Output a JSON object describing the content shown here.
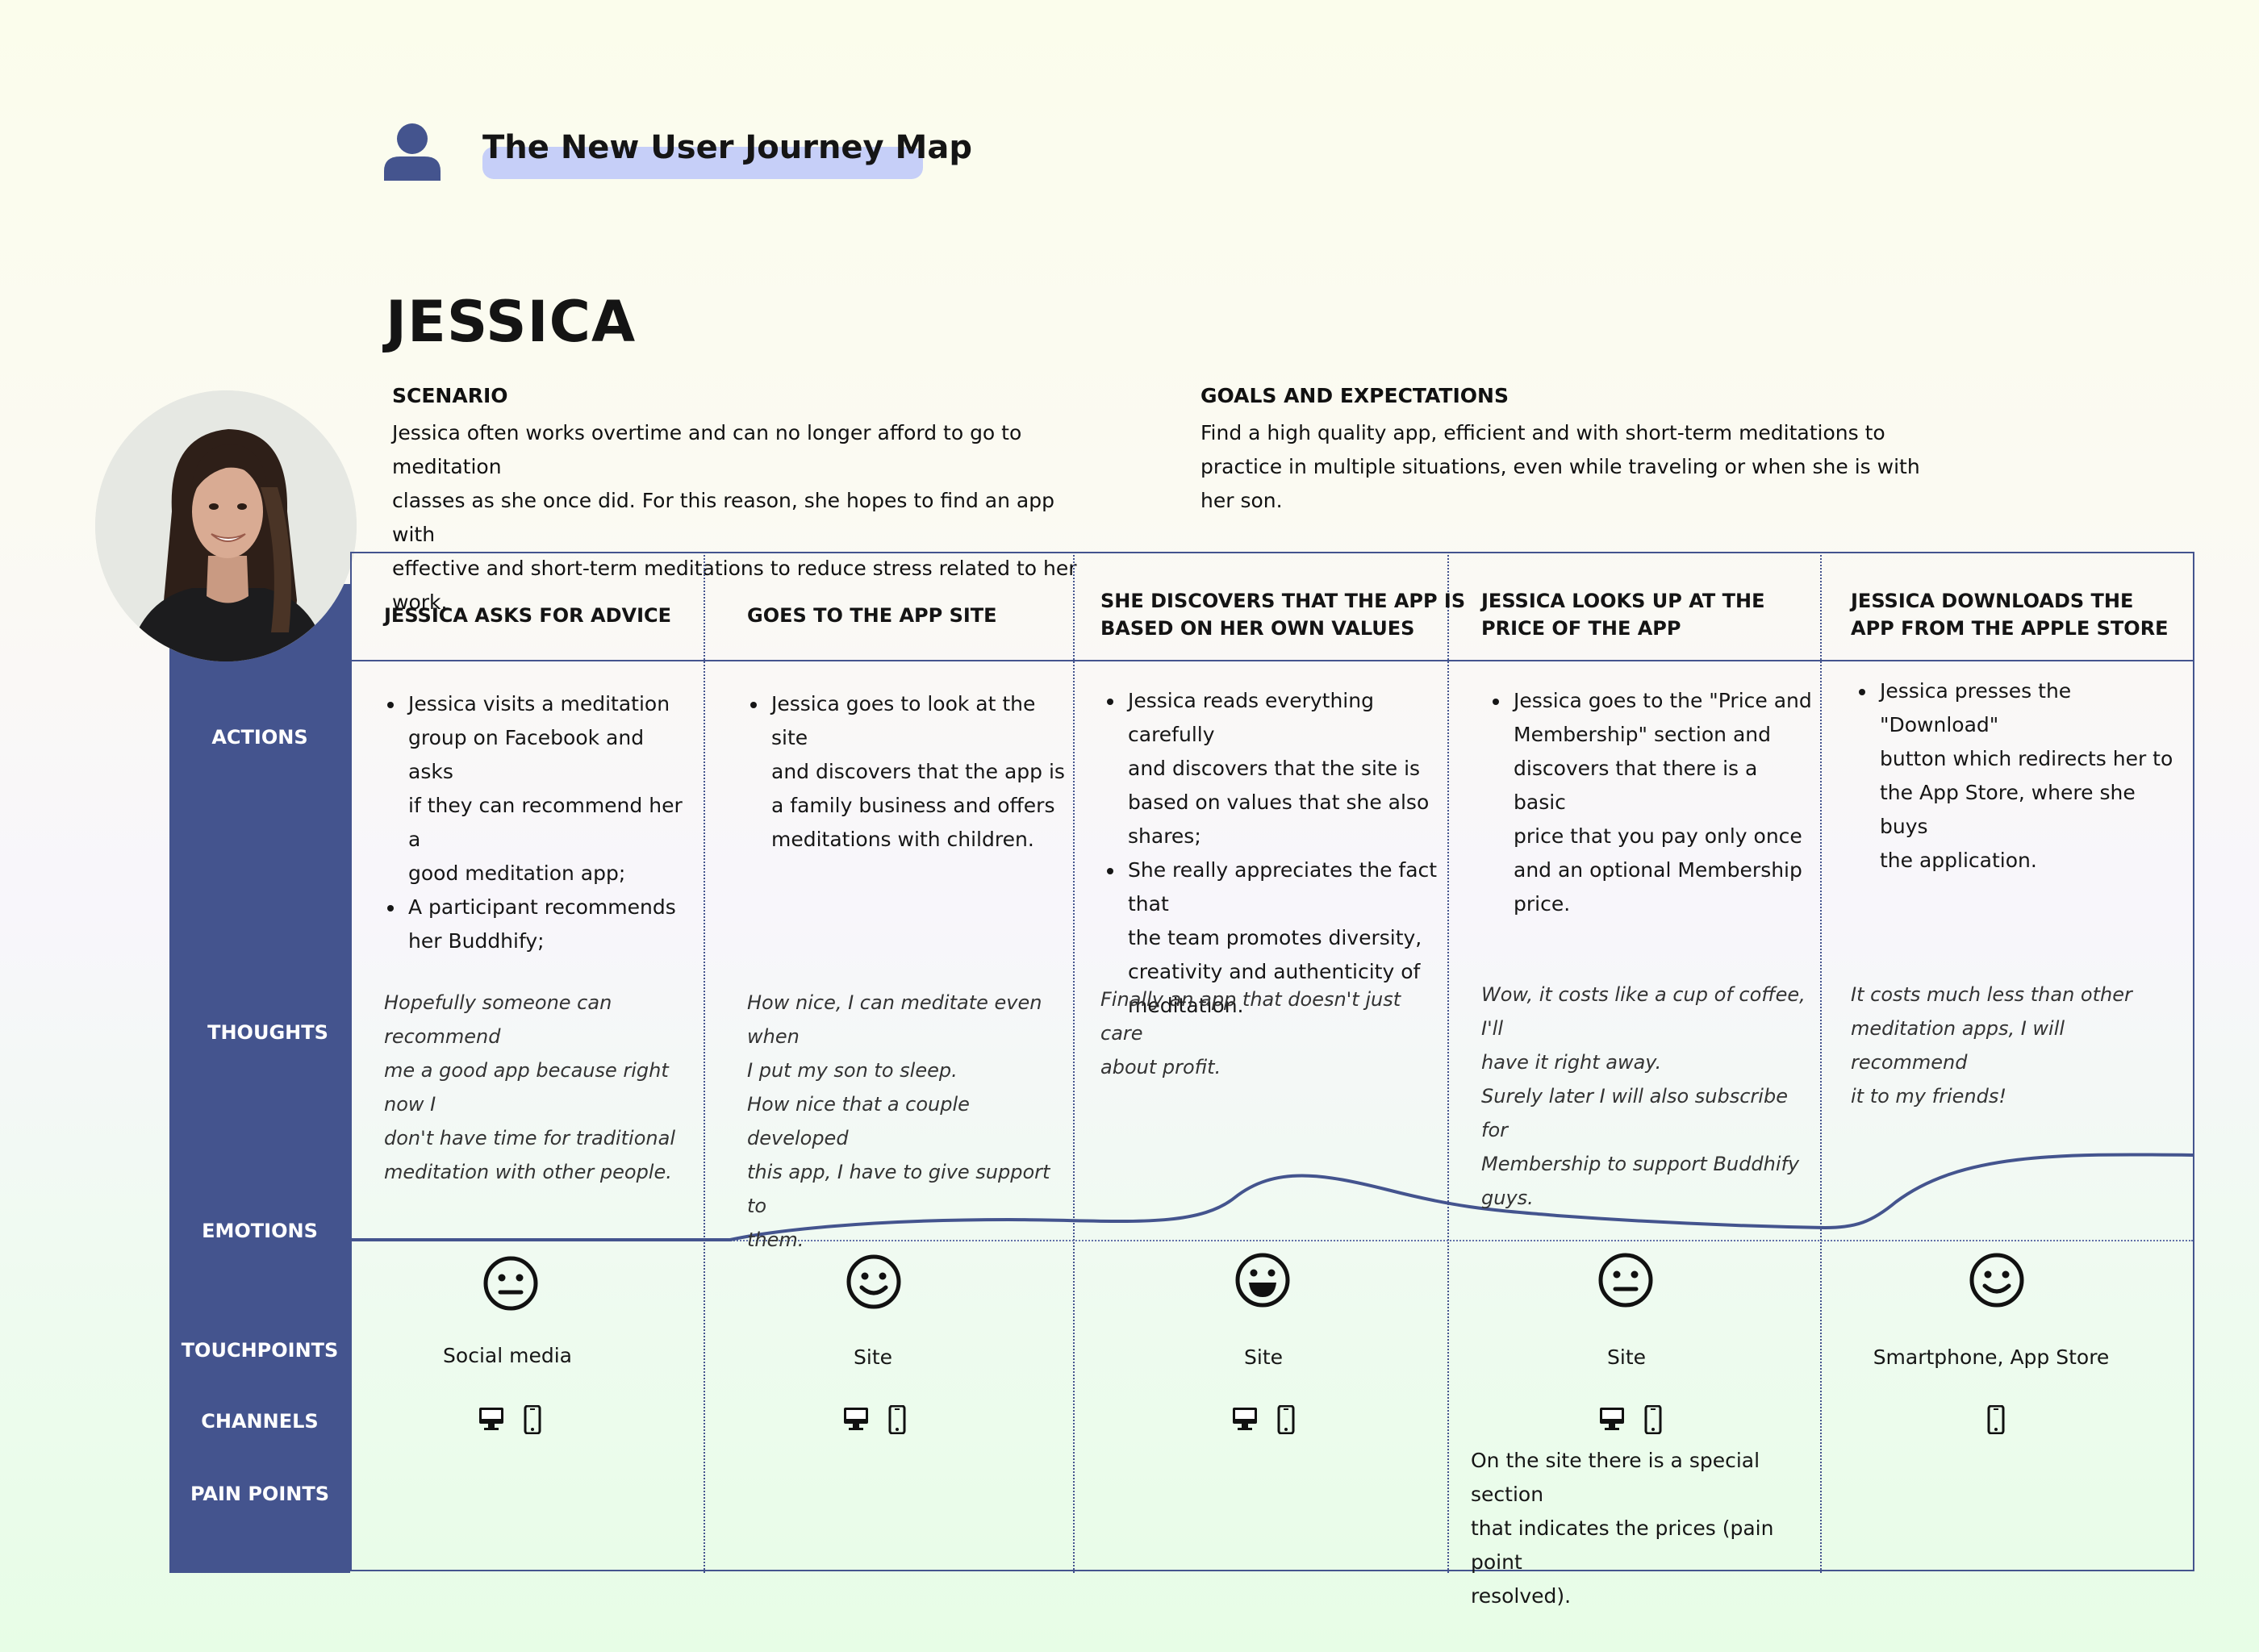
{
  "header": {
    "title": "The New User Journey Map",
    "user_icon": "user-icon"
  },
  "persona": {
    "name": "JESSICA",
    "scenario_heading": "SCENARIO",
    "scenario_lines": [
      "Jessica often works overtime and can no longer afford to go to meditation",
      "classes as she once did. For this reason, she hopes to find an app with",
      "effective and short-term meditations to reduce stress related to her work."
    ],
    "goals_heading": "GOALS AND EXPECTATIONS",
    "goals_lines": [
      "Find a high quality app, efficient and with short-term meditations to",
      "practice in multiple situations, even while traveling or when she is with",
      "her son."
    ]
  },
  "row_labels": {
    "actions": "ACTIONS",
    "thoughts": "THOUGHTS",
    "emotions": "EMOTIONS",
    "touchpoints": "TOUCHPOINTS",
    "channels": "CHANNELS",
    "pain_points": "PAIN POINTS"
  },
  "stages": [
    {
      "heading": [
        "JESSICA ASKS FOR ADVICE"
      ],
      "actions": [
        [
          "Jessica visits a meditation",
          "group on Facebook and asks",
          "if they can recommend her a",
          "good meditation app;"
        ],
        [
          "A participant recommends",
          "her Buddhify;"
        ]
      ],
      "thoughts": [
        [
          "Hopefully someone can recommend",
          "me a good app because right now I",
          "don't have time for traditional",
          "meditation with other people."
        ]
      ],
      "emotion": "neutral-face-icon",
      "touchpoint": "Social media",
      "channels": [
        "desktop-icon",
        "smartphone-icon"
      ],
      "pain_point": []
    },
    {
      "heading": [
        "GOES TO THE APP SITE"
      ],
      "actions": [
        [
          "Jessica goes to look at the site",
          "and discovers that the app is",
          "a family business and offers",
          "meditations with children."
        ]
      ],
      "thoughts": [
        [
          "How nice, I can meditate even when",
          "I put my son to sleep."
        ],
        [
          "How nice that a couple developed",
          "this app, I have to give support to",
          "them."
        ]
      ],
      "emotion": "smiling-face-icon",
      "touchpoint": "Site",
      "channels": [
        "desktop-icon",
        "smartphone-icon"
      ],
      "pain_point": []
    },
    {
      "heading": [
        "SHE DISCOVERS THAT THE APP IS",
        "BASED ON HER OWN VALUES"
      ],
      "actions": [
        [
          "Jessica reads everything carefully",
          "and discovers that the site is",
          "based on values that she also",
          "shares;"
        ],
        [
          "She really appreciates the fact that",
          "the team promotes diversity,",
          "creativity and authenticity of",
          "meditation."
        ]
      ],
      "thoughts": [
        [
          "Finally an app that doesn't just care",
          "about profit."
        ]
      ],
      "emotion": "happy-face-icon",
      "touchpoint": "Site",
      "channels": [
        "desktop-icon",
        "smartphone-icon"
      ],
      "pain_point": []
    },
    {
      "heading": [
        "JESSICA LOOKS UP AT THE",
        "PRICE OF THE APP"
      ],
      "actions": [
        [
          "Jessica goes to the \"Price and",
          "Membership\" section and",
          "discovers that there is a basic",
          "price that you pay only once",
          "and an optional Membership",
          "price."
        ]
      ],
      "thoughts": [
        [
          "Wow, it costs like a cup of coffee, I'll",
          "have it right away."
        ],
        [
          "Surely later I will also subscribe for",
          "Membership to support Buddhify",
          "guys."
        ]
      ],
      "emotion": "neutral-face-icon",
      "touchpoint": "Site",
      "channels": [
        "desktop-icon",
        "smartphone-icon"
      ],
      "pain_point": [
        "On the site there is a special section",
        "that indicates the prices (pain point",
        "resolved)."
      ]
    },
    {
      "heading": [
        "JESSICA DOWNLOADS THE",
        "APP FROM THE APPLE STORE"
      ],
      "actions": [
        [
          "Jessica presses the \"Download\"",
          "button which redirects her to",
          "the App Store, where she buys",
          "the application."
        ]
      ],
      "thoughts": [
        [
          "It costs much less than other",
          "meditation apps, I will recommend",
          "it to my friends!"
        ]
      ],
      "emotion": "smiling-face-icon",
      "touchpoint": "Smartphone, App Store",
      "channels": [
        "smartphone-icon"
      ],
      "pain_point": []
    }
  ],
  "colors": {
    "band": "#44548e",
    "title_highlight": "#c6cff8",
    "emotion_line": "#44548e"
  }
}
